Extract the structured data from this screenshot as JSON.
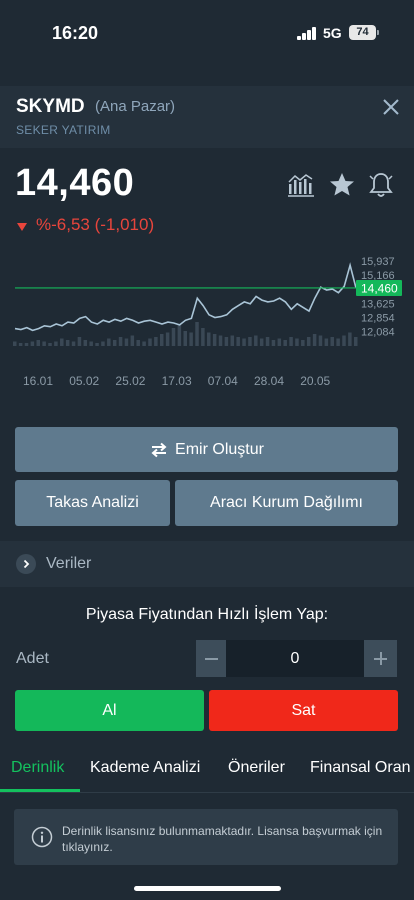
{
  "status_bar": {
    "time": "16:20",
    "network": "5G",
    "battery": "74"
  },
  "header": {
    "symbol": "SKYMD",
    "market": "(Ana Pazar)",
    "company": "SEKER YATIRIM"
  },
  "quote": {
    "price": "14,460",
    "change": "%-6,53 (-1,010)"
  },
  "colors": {
    "up": "#14b85a",
    "down": "#e8453c",
    "accent": "#14c15e",
    "line": "#a9c4d6"
  },
  "chart_data": {
    "type": "line",
    "x_labels": [
      "16.01",
      "05.02",
      "25.02",
      "17.03",
      "07.04",
      "28.04",
      "20.05"
    ],
    "y_labels": [
      "15,937",
      "15,166",
      "13,625",
      "12,854",
      "12,084"
    ],
    "current_price_label": "14,460",
    "ylim": [
      11.3,
      16.2
    ],
    "current_price": 14.46,
    "series": [
      {
        "values": [
          12.25,
          12.2,
          12.3,
          12.15,
          12.25,
          12.4,
          12.35,
          12.5,
          12.4,
          12.6,
          12.55,
          12.8,
          12.9,
          12.6,
          12.5,
          12.7,
          12.6,
          12.75,
          12.65,
          12.8,
          12.7,
          12.55,
          12.65,
          12.7,
          12.6,
          12.5,
          12.6,
          12.55,
          12.45,
          12.7,
          12.8,
          13.9,
          13.5,
          13.0,
          12.85,
          12.9,
          13.0,
          13.3,
          13.5,
          13.7,
          13.6,
          14.0,
          13.8,
          13.7,
          13.75,
          13.9,
          13.7,
          13.3,
          13.6,
          13.4,
          13.2,
          13.9,
          14.5,
          14.35,
          14.4,
          14.2,
          14.55,
          15.7,
          14.46
        ]
      }
    ],
    "volume": [
      3,
      2,
      2,
      3,
      4,
      3,
      2,
      3,
      5,
      4,
      3,
      6,
      4,
      3,
      2,
      3,
      5,
      4,
      6,
      5,
      7,
      4,
      3,
      5,
      6,
      8,
      9,
      12,
      14,
      10,
      9,
      16,
      12,
      9,
      8,
      7,
      6,
      7,
      6,
      5,
      6,
      7,
      5,
      6,
      4,
      5,
      4,
      6,
      5,
      4,
      6,
      8,
      7,
      5,
      6,
      5,
      7,
      9,
      6
    ]
  },
  "buttons": {
    "emir": "Emir Oluştur",
    "takas": "Takas Analizi",
    "araci": "Aracı Kurum Dağılımı",
    "veriler": "Veriler"
  },
  "quick_trade": {
    "title": "Piyasa Fiyatından Hızlı İşlem Yap:",
    "quantity_label": "Adet",
    "quantity_value": "0",
    "buy": "Al",
    "sell": "Sat"
  },
  "tabs": [
    "Derinlik",
    "Kademe Analizi",
    "Öneriler",
    "Finansal Oran"
  ],
  "notice": "Derinlik lisansınız bulunmamaktadır. Lisansa başvurmak için tıklayınız.",
  "icons": {
    "close": "close-icon",
    "analysis": "bar-chart-icon",
    "favorite": "star-icon",
    "alert": "bell-icon",
    "order": "swap-arrows-icon",
    "expand": "chevron-right-icon",
    "info": "info-icon"
  }
}
